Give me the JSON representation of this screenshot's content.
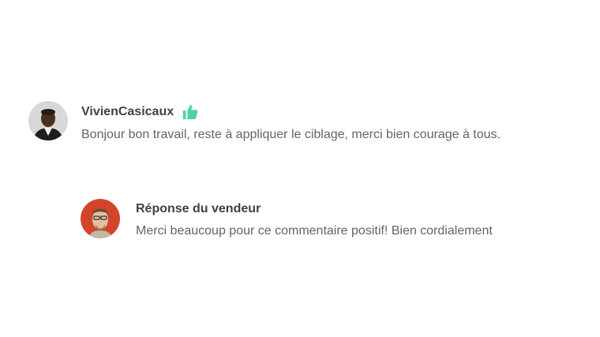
{
  "review": {
    "username": "VivienCasicaux",
    "avatar_icon": "user-avatar",
    "rating_icon": "thumbs-up-icon",
    "rating_color": "#4fd1a8",
    "comment": "Bonjour bon travail, reste à appliquer le ciblage, merci bien courage à tous."
  },
  "seller_reply": {
    "avatar_icon": "seller-avatar",
    "title": "Réponse du vendeur",
    "text": "Merci beaucoup pour ce commentaire positif! Bien cordialement"
  }
}
